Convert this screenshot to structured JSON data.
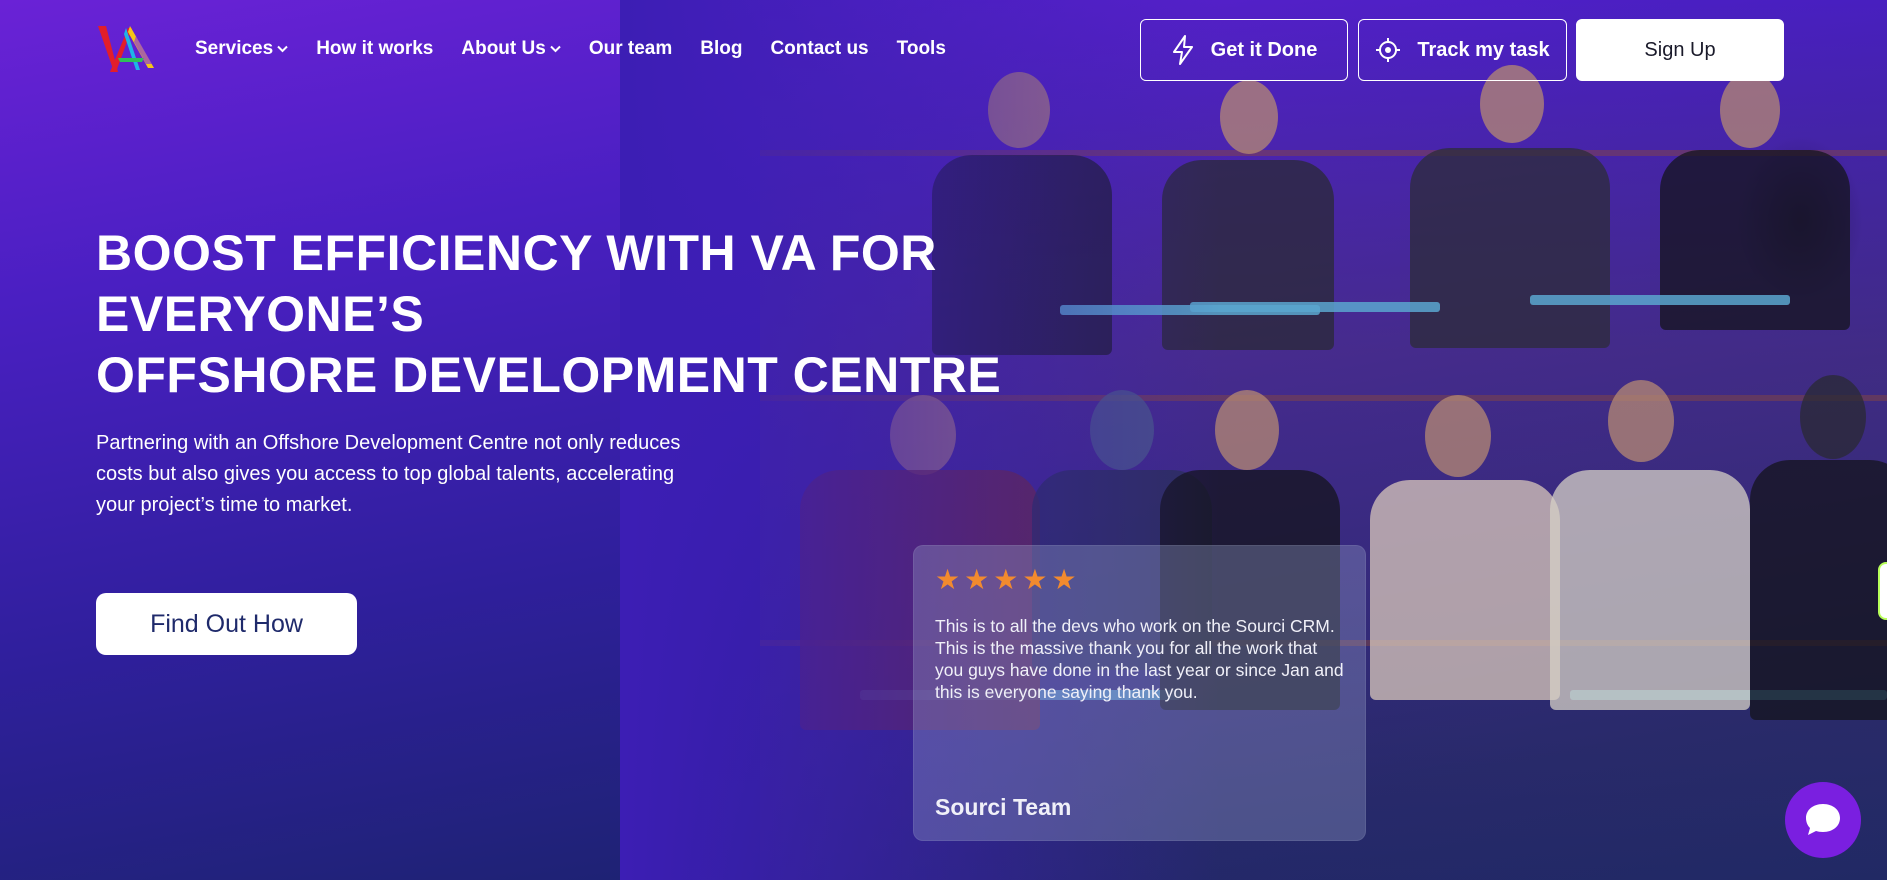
{
  "nav": {
    "items": [
      {
        "label": "Services",
        "has_dropdown": true
      },
      {
        "label": "How it works",
        "has_dropdown": false
      },
      {
        "label": "About Us",
        "has_dropdown": true
      },
      {
        "label": "Our team",
        "has_dropdown": false
      },
      {
        "label": "Blog",
        "has_dropdown": false
      },
      {
        "label": "Contact us",
        "has_dropdown": false
      },
      {
        "label": "Tools",
        "has_dropdown": false
      }
    ],
    "chevron": "⌄"
  },
  "header_buttons": {
    "get_done": "Get it Done",
    "track": "Track my task",
    "signup": "Sign Up"
  },
  "hero": {
    "headline_lines": [
      "BOOST EFFICIENCY WITH VA FOR",
      "EVERYONE’S",
      "OFFSHORE DEVELOPMENT CENTRE"
    ],
    "subtext": "Partnering with an Offshore Development Centre not only reduces costs but also gives you access to top global talents, accelerating your project’s time to market.",
    "cta": "Find Out How"
  },
  "review": {
    "stars": 5,
    "text": "This is to all the devs who work on the Sourci CRM. This is the massive thank you for all the work that you guys have done in the last year or since Jan and this is everyone saying thank you.",
    "author": "Sourci Team"
  },
  "colors": {
    "accent_star": "#f28a2e",
    "chat_button": "#7a1fe0",
    "hero_gradient_top": "#6a22d6",
    "hero_gradient_bottom": "#172466"
  },
  "icons": {
    "get_done": "lightning-icon",
    "track": "crosshair-icon",
    "chat": "chat-bubble-icon"
  }
}
